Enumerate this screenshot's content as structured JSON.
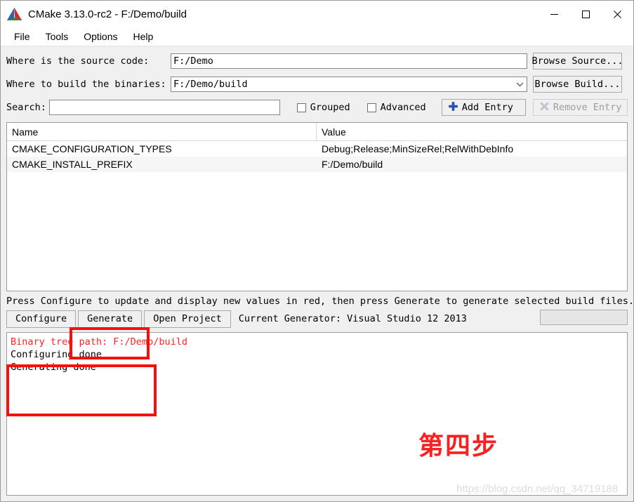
{
  "window": {
    "title": "CMake 3.13.0-rc2 - F:/Demo/build",
    "logo_icon": "cmake-logo-icon",
    "minimize_icon": "minimize-icon",
    "maximize_icon": "maximize-icon",
    "close_icon": "close-icon"
  },
  "menubar": {
    "items": [
      {
        "label": "File"
      },
      {
        "label": "Tools"
      },
      {
        "label": "Options"
      },
      {
        "label": "Help"
      }
    ]
  },
  "form": {
    "source_label": "Where is the source code:",
    "source_value": "F:/Demo",
    "browse_source_label": "Browse Source...",
    "build_label": "Where to build the binaries:",
    "build_value": "F:/Demo/build",
    "browse_build_label": "Browse Build...",
    "search_label": "Search:",
    "search_value": "",
    "search_placeholder": ""
  },
  "options": {
    "grouped_label": "Grouped",
    "grouped_checked": false,
    "advanced_label": "Advanced",
    "advanced_checked": false,
    "add_entry_label": "Add Entry",
    "add_entry_icon": "plus-icon",
    "remove_entry_label": "Remove Entry",
    "remove_entry_icon": "remove-x-icon",
    "remove_entry_enabled": false
  },
  "cache_table": {
    "columns": [
      "Name",
      "Value"
    ],
    "rows": [
      {
        "name": "CMAKE_CONFIGURATION_TYPES",
        "value": "Debug;Release;MinSizeRel;RelWithDebInfo"
      },
      {
        "name": "CMAKE_INSTALL_PREFIX",
        "value": "F:/Demo/build"
      }
    ]
  },
  "status": {
    "hint": "Press Configure to update and display new values in red, then press Generate to generate selected build files."
  },
  "actions": {
    "configure_label": "Configure",
    "generate_label": "Generate",
    "open_project_label": "Open Project",
    "current_generator": "Current Generator: Visual Studio 12 2013",
    "progress_value": 0
  },
  "output_log": {
    "lines": [
      {
        "text": "Binary tree path: F:/Demo/build",
        "color": "#ff2424"
      },
      {
        "text": "Configuring done",
        "color": "#000000"
      },
      {
        "text": "Generating done",
        "color": "#000000"
      }
    ]
  },
  "annotations": {
    "step_text": "第四步",
    "highlight_color": "#fa0d0d",
    "watermark": "https://blog.csdn.net/qq_34719188"
  }
}
